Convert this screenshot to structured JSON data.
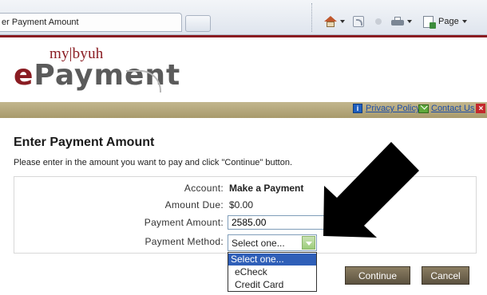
{
  "browser": {
    "tab_title": "er Payment Amount",
    "page_label": "Page"
  },
  "header": {
    "logo_small": "my|byuh",
    "logo_main_e": "e",
    "logo_main_rest": "Payment"
  },
  "utility": {
    "privacy_label": "Privacy Policy",
    "contact_label": "Contact Us"
  },
  "main": {
    "title": "Enter Payment Amount",
    "instructions": "Please enter in the amount you want to pay and click \"Continue\" button.",
    "fields": {
      "account_label": "Account:",
      "account_value": "Make a Payment",
      "amount_due_label": "Amount Due:",
      "amount_due_value": "$0.00",
      "payment_amount_label": "Payment Amount:",
      "payment_amount_value": "2585.00",
      "payment_method_label": "Payment Method:",
      "payment_method_selected": "Select one..."
    },
    "payment_method_options": [
      "Select one...",
      "eCheck",
      "Credit Card"
    ],
    "continue_label": "Continue",
    "cancel_label": "Cancel"
  },
  "colors": {
    "brand_maroon": "#8a1c22",
    "utility_bar": "#b5a87c",
    "selected_option": "#2f5fb8"
  }
}
